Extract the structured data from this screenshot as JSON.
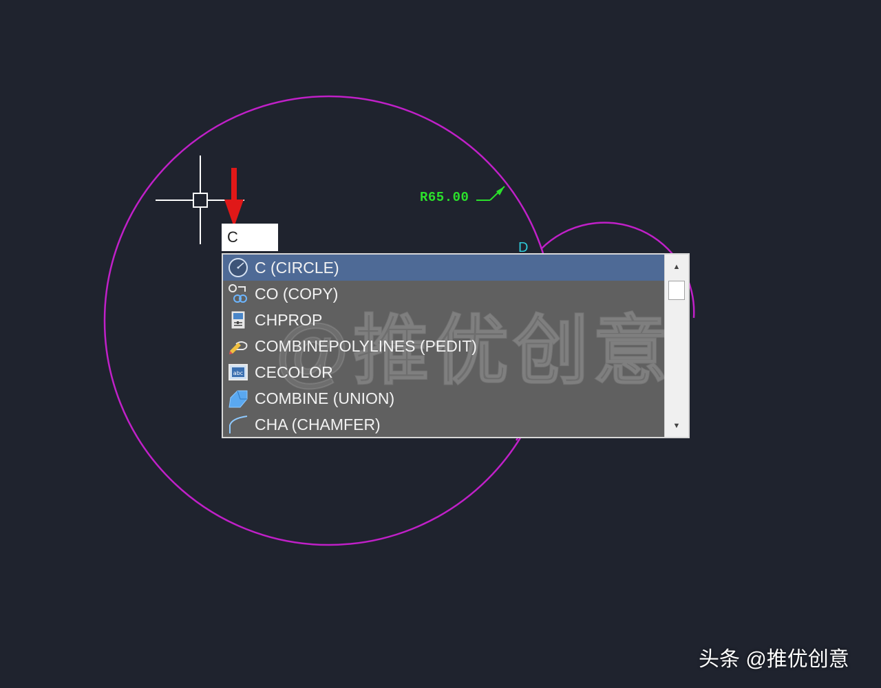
{
  "drawing": {
    "dimension_label": "R65.00",
    "point_label": "D",
    "circle_color": "#c020c8",
    "dimension_color": "#2be02b",
    "point_label_color": "#2ec9d8",
    "arrow_color": "#e01818"
  },
  "command_line": {
    "input_value": "C"
  },
  "autocomplete": {
    "items": [
      {
        "label": "C (CIRCLE)",
        "icon": "circle-icon",
        "selected": true
      },
      {
        "label": "CO (COPY)",
        "icon": "copy-icon",
        "selected": false
      },
      {
        "label": "CHPROP",
        "icon": "properties-icon",
        "selected": false
      },
      {
        "label": "COMBINEPOLYLINES (PEDIT)",
        "icon": "pedit-icon",
        "selected": false
      },
      {
        "label": "CECOLOR",
        "icon": "color-icon",
        "selected": false
      },
      {
        "label": "COMBINE (UNION)",
        "icon": "union-icon",
        "selected": false
      },
      {
        "label": "CHA (CHAMFER)",
        "icon": "chamfer-icon",
        "selected": false
      }
    ],
    "scroll_up": "▲",
    "scroll_down": "▼"
  },
  "watermark": {
    "center": "@推优创意",
    "corner": "头条 @推优创意"
  }
}
